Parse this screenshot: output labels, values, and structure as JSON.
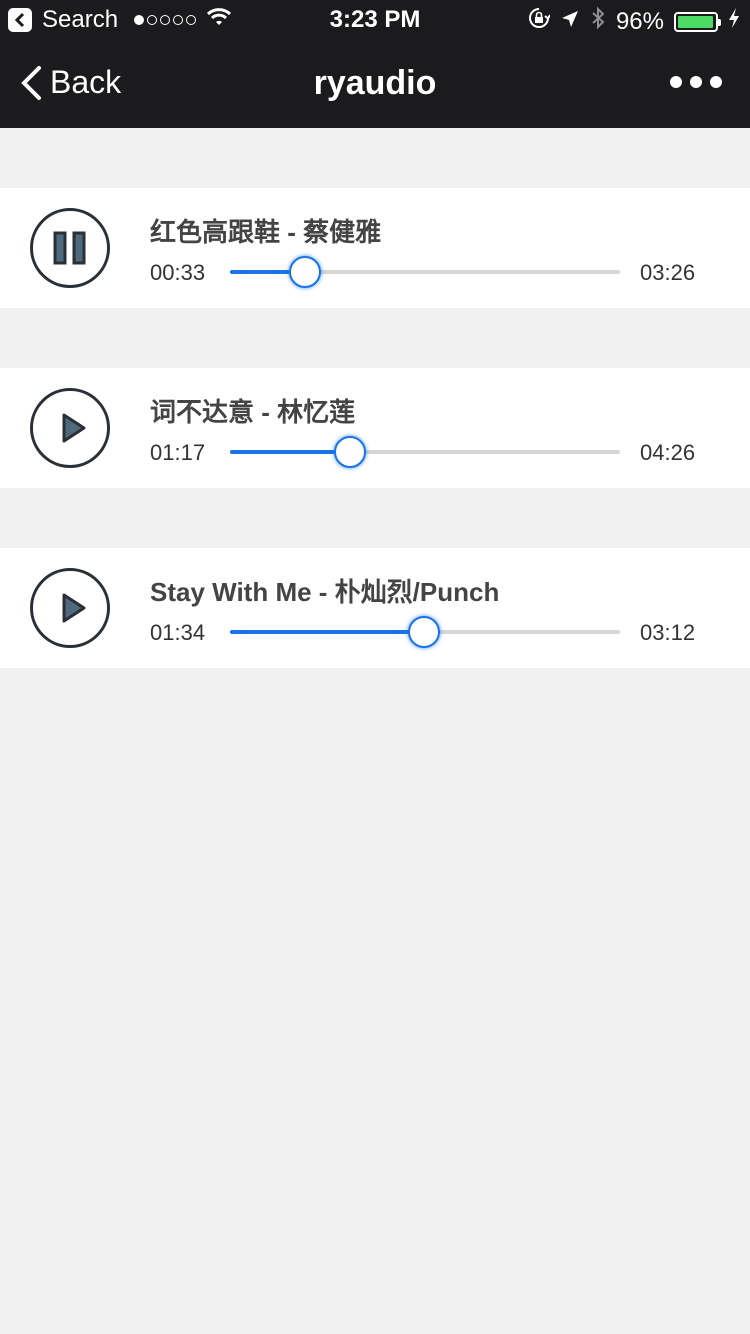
{
  "status_bar": {
    "back_app_label": "Search",
    "time": "3:23 PM",
    "battery": "96%",
    "battery_level": 0.96,
    "signal_filled": 1,
    "signal_total": 5
  },
  "nav": {
    "back_label": "Back",
    "title": "ryaudio"
  },
  "colors": {
    "accent": "#1a73e8",
    "nav_bg": "#1b1b1d",
    "page_bg": "#f1f1f1",
    "battery": "#4cd964"
  },
  "tracks": [
    {
      "title": "红色高跟鞋 - 蔡健雅",
      "current": "00:33",
      "total": "03:26",
      "progress": 0.19,
      "state": "playing",
      "icon": "pause-icon"
    },
    {
      "title": "词不达意 - 林忆莲",
      "current": "01:17",
      "total": "04:26",
      "progress": 0.305,
      "state": "paused",
      "icon": "play-icon"
    },
    {
      "title": "Stay With Me - 朴灿烈/Punch",
      "current": "01:34",
      "total": "03:12",
      "progress": 0.495,
      "state": "paused",
      "icon": "play-icon"
    }
  ]
}
